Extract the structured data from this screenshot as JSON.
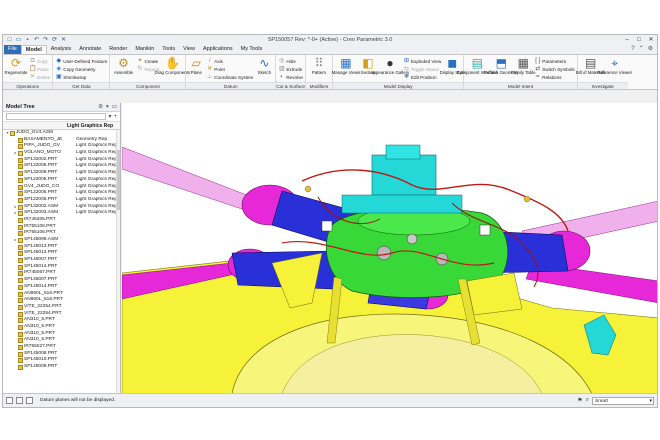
{
  "window": {
    "title": "SP150057 Rev: *-0+ (Active) - Creo Parametric 3.0"
  },
  "quick_access": [
    "new-icon",
    "open-icon",
    "save-icon",
    "undo-icon",
    "redo-icon",
    "regenerate-icon",
    "close-window-icon"
  ],
  "tabs": [
    {
      "label": "File",
      "kind": "file"
    },
    {
      "label": "Model",
      "kind": "active"
    },
    {
      "label": "Analysis",
      "kind": ""
    },
    {
      "label": "Annotate",
      "kind": ""
    },
    {
      "label": "Render",
      "kind": ""
    },
    {
      "label": "Manikin",
      "kind": ""
    },
    {
      "label": "Tools",
      "kind": ""
    },
    {
      "label": "View",
      "kind": ""
    },
    {
      "label": "Applications",
      "kind": ""
    },
    {
      "label": "My Tools",
      "kind": ""
    }
  ],
  "ribbon": {
    "operations": {
      "label": "Operations",
      "regenerate": "Regenerate",
      "copy": "Copy",
      "paste": "Paste",
      "delete": "Delete"
    },
    "get_data": {
      "label": "Get Data",
      "user_defined_feature": "User-Defined Feature",
      "copy_geometry": "Copy Geometry",
      "shrinkwrap": "Shrinkwrap"
    },
    "component": {
      "label": "Component",
      "assemble": "Assemble",
      "create": "Create",
      "repeat": "Repeat",
      "drag_components": "Drag Components"
    },
    "datum": {
      "label": "Datum",
      "plane": "Plane",
      "axis": "Axis",
      "point": "Point",
      "coordinate_system": "Coordinate System",
      "sketch": "Sketch"
    },
    "cut_surface": {
      "label": "Cut & Surface",
      "hole": "Hole",
      "extrude": "Extrude",
      "revolve": "Revolve"
    },
    "modifiers": {
      "label": "Modifiers",
      "pattern": "Pattern"
    },
    "model_display": {
      "label": "Model Display",
      "manage_views": "Manage Views",
      "section": "Section",
      "appearance_gallery": "Appearance Gallery",
      "exploded_view": "Exploded View",
      "toggle_status": "Toggle Status",
      "edit_position": "Edit Position",
      "display_style": "Display Style"
    },
    "model_intent": {
      "label": "Model Intent",
      "component_interface": "Component Interface",
      "publish_geometry": "Publish Geometry",
      "family_table": "Family Table",
      "parameters": "Parameters",
      "switch_symbols": "Switch Symbols",
      "relations": "Relations"
    },
    "investigate": {
      "label": "Investigate",
      "bill_of_materials": "Bill of Materials",
      "reference_viewer": "Reference Viewer"
    }
  },
  "model_tree": {
    "title": "Model Tree",
    "column_header": "Light Graphics Rep",
    "rows": [
      {
        "name": "JUDO_GV4.ASM",
        "rep": "",
        "asm": true,
        "expand": "▾"
      },
      {
        "name": "BASAMENTO_JE",
        "rep": "Geometry Rep",
        "asm": false,
        "expand": ""
      },
      {
        "name": "PIPA_JUDO_GV",
        "rep": "Light Graphics Rep",
        "asm": false,
        "expand": ""
      },
      {
        "name": "VOLANO_MOTO",
        "rep": "Light Graphics Rep",
        "asm": true,
        "expand": "▸"
      },
      {
        "name": "SP132002.PRT",
        "rep": "Light Graphics Rep",
        "asm": false,
        "expand": ""
      },
      {
        "name": "SP122005.PRT",
        "rep": "Light Graphics Rep",
        "asm": false,
        "expand": ""
      },
      {
        "name": "SP132008.PRT",
        "rep": "Light Graphics Rep",
        "asm": false,
        "expand": ""
      },
      {
        "name": "SP122005.PRT",
        "rep": "Light Graphics Rep",
        "asm": false,
        "expand": ""
      },
      {
        "name": "GV4_JUDO_CO",
        "rep": "Light Graphics Rep",
        "asm": false,
        "expand": ""
      },
      {
        "name": "SP122005.PRT",
        "rep": "Light Graphics Rep",
        "asm": false,
        "expand": ""
      },
      {
        "name": "SP122005.PRT",
        "rep": "Light Graphics Rep",
        "asm": false,
        "expand": ""
      },
      {
        "name": "SP132002.ASM",
        "rep": "Light Graphics Rep",
        "asm": true,
        "expand": "▸"
      },
      {
        "name": "SP132003.ASM",
        "rep": "Light Graphics Rep",
        "asm": true,
        "expand": "▸"
      },
      {
        "name": "IR745205.PRT",
        "rep": "",
        "asm": false,
        "expand": ""
      },
      {
        "name": "IR755106.PRT",
        "rep": "",
        "asm": false,
        "expand": ""
      },
      {
        "name": "IR755106.PRT",
        "rep": "",
        "asm": false,
        "expand": ""
      },
      {
        "name": "SP145099.ASM",
        "rep": "",
        "asm": true,
        "expand": "▸"
      },
      {
        "name": "SP145013.PRT",
        "rep": "",
        "asm": false,
        "expand": ""
      },
      {
        "name": "SP145013.PRT",
        "rep": "",
        "asm": false,
        "expand": ""
      },
      {
        "name": "SP145007.PRT",
        "rep": "",
        "asm": false,
        "expand": ""
      },
      {
        "name": "SP145014.PRT",
        "rep": "",
        "asm": false,
        "expand": ""
      },
      {
        "name": "IR745067.PRT",
        "rep": "",
        "asm": false,
        "expand": ""
      },
      {
        "name": "SP145007.PRT",
        "rep": "",
        "asm": false,
        "expand": ""
      },
      {
        "name": "SP145014.PRT",
        "rep": "",
        "asm": false,
        "expand": ""
      },
      {
        "name": "AN960L_516.PRT",
        "rep": "",
        "asm": false,
        "expand": ""
      },
      {
        "name": "AN960L_516.PRT",
        "rep": "",
        "asm": false,
        "expand": ""
      },
      {
        "name": "VITE_22254.PRT",
        "rep": "",
        "asm": false,
        "expand": ""
      },
      {
        "name": "VITE_22254.PRT",
        "rep": "",
        "asm": false,
        "expand": ""
      },
      {
        "name": "AN310_5.PRT",
        "rep": "",
        "asm": false,
        "expand": ""
      },
      {
        "name": "AN310_5.PRT",
        "rep": "",
        "asm": false,
        "expand": ""
      },
      {
        "name": "AN310_5.PRT",
        "rep": "",
        "asm": false,
        "expand": ""
      },
      {
        "name": "AN310_5.PRT",
        "rep": "",
        "asm": false,
        "expand": ""
      },
      {
        "name": "IR755027.PRT",
        "rep": "",
        "asm": false,
        "expand": ""
      },
      {
        "name": "SP145008.PRT",
        "rep": "",
        "asm": false,
        "expand": ""
      },
      {
        "name": "SP145010.PRT",
        "rep": "",
        "asm": false,
        "expand": ""
      },
      {
        "name": "SP145008.PRT",
        "rep": "",
        "asm": false,
        "expand": ""
      }
    ]
  },
  "status": {
    "message": "Datum planes will not be displayed.",
    "filter_value": "Smart"
  },
  "colors": {
    "viewport_bg": "#ffffff",
    "blade_magenta": "#e628d8",
    "blade_pink": "#f0b0ec",
    "hub_green": "#38d838",
    "hub_blue": "#2a30d8",
    "body_yellow": "#f6f23a",
    "cyan": "#24d8d8",
    "wire_red": "#c01818"
  }
}
